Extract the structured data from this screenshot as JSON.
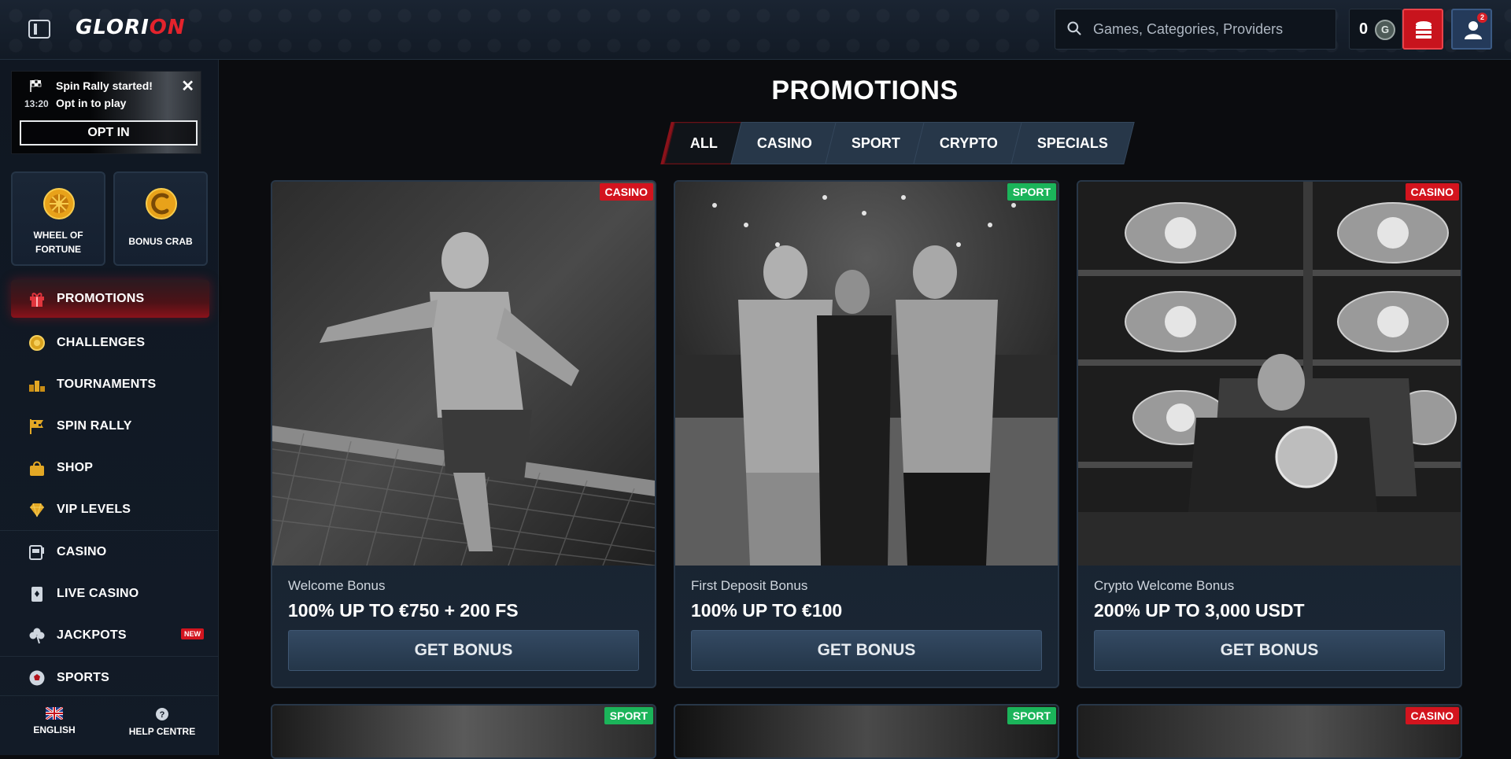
{
  "brand": {
    "logo_main": "GLORI",
    "logo_accent": "ON"
  },
  "header": {
    "search_placeholder": "Games, Categories, Providers",
    "balance": "0",
    "balance_currency": "G",
    "notification_count": "2"
  },
  "spin_rally": {
    "title": "Spin Rally started!",
    "time": "13:20",
    "subtitle": "Opt in to play",
    "opt_in_label": "OPT IN"
  },
  "tiles": [
    {
      "label": "WHEEL OF FORTUNE",
      "icon": "wheel-icon"
    },
    {
      "label": "BONUS CRAB",
      "icon": "crab-coin-icon"
    }
  ],
  "nav": [
    {
      "label": "PROMOTIONS",
      "icon": "gift-icon",
      "active": true
    },
    {
      "label": "CHALLENGES",
      "icon": "medal-icon"
    },
    {
      "label": "TOURNAMENTS",
      "icon": "podium-icon"
    },
    {
      "label": "SPIN RALLY",
      "icon": "flag-icon"
    },
    {
      "label": "SHOP",
      "icon": "bag-icon"
    },
    {
      "label": "VIP LEVELS",
      "icon": "diamond-icon"
    },
    {
      "label": "CASINO",
      "icon": "slot-machine-icon"
    },
    {
      "label": "LIVE CASINO",
      "icon": "card-icon"
    },
    {
      "label": "JACKPOTS",
      "icon": "clover-icon",
      "badge": "NEW"
    },
    {
      "label": "SPORTS",
      "icon": "ball-icon"
    }
  ],
  "footer": {
    "language": "ENGLISH",
    "help": "HELP CENTRE"
  },
  "page_title": "PROMOTIONS",
  "tabs": [
    {
      "label": "ALL",
      "active": true
    },
    {
      "label": "CASINO"
    },
    {
      "label": "SPORT"
    },
    {
      "label": "CRYPTO"
    },
    {
      "label": "SPECIALS"
    }
  ],
  "promotions": [
    {
      "badge": "CASINO",
      "subtitle": "Welcome Bonus",
      "title": "100% UP TO €750 + 200 FS",
      "button": "GET BONUS"
    },
    {
      "badge": "SPORT",
      "subtitle": "First Deposit Bonus",
      "title": "100% UP TO €100",
      "button": "GET BONUS"
    },
    {
      "badge": "CASINO",
      "subtitle": "Crypto Welcome Bonus",
      "title": "200% UP TO 3,000 USDT",
      "button": "GET BONUS"
    },
    {
      "badge": "SPORT"
    },
    {
      "badge": "SPORT"
    },
    {
      "badge": "CASINO"
    }
  ],
  "colors": {
    "accent_red": "#d3141e",
    "sport_green": "#1bb45a",
    "panel": "#1a2634"
  }
}
